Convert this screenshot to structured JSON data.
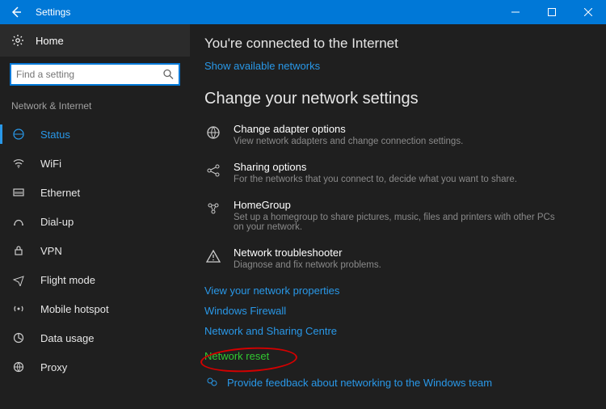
{
  "titlebar": {
    "title": "Settings"
  },
  "sidebar": {
    "home": "Home",
    "search_placeholder": "Find a setting",
    "group": "Network & Internet",
    "items": [
      {
        "label": "Status"
      },
      {
        "label": "WiFi"
      },
      {
        "label": "Ethernet"
      },
      {
        "label": "Dial-up"
      },
      {
        "label": "VPN"
      },
      {
        "label": "Flight mode"
      },
      {
        "label": "Mobile hotspot"
      },
      {
        "label": "Data usage"
      },
      {
        "label": "Proxy"
      }
    ]
  },
  "main": {
    "connected_heading": "You're connected to the Internet",
    "show_networks": "Show available networks",
    "change_heading": "Change your network settings",
    "rows": [
      {
        "title": "Change adapter options",
        "desc": "View network adapters and change connection settings."
      },
      {
        "title": "Sharing options",
        "desc": "For the networks that you connect to, decide what you want to share."
      },
      {
        "title": "HomeGroup",
        "desc": "Set up a homegroup to share pictures, music, files and printers with other PCs on your network."
      },
      {
        "title": "Network troubleshooter",
        "desc": "Diagnose and fix network problems."
      }
    ],
    "view_properties": "View your network properties",
    "firewall": "Windows Firewall",
    "sharing_centre": "Network and Sharing Centre",
    "network_reset": "Network reset",
    "feedback": "Provide feedback about networking to the Windows team"
  }
}
